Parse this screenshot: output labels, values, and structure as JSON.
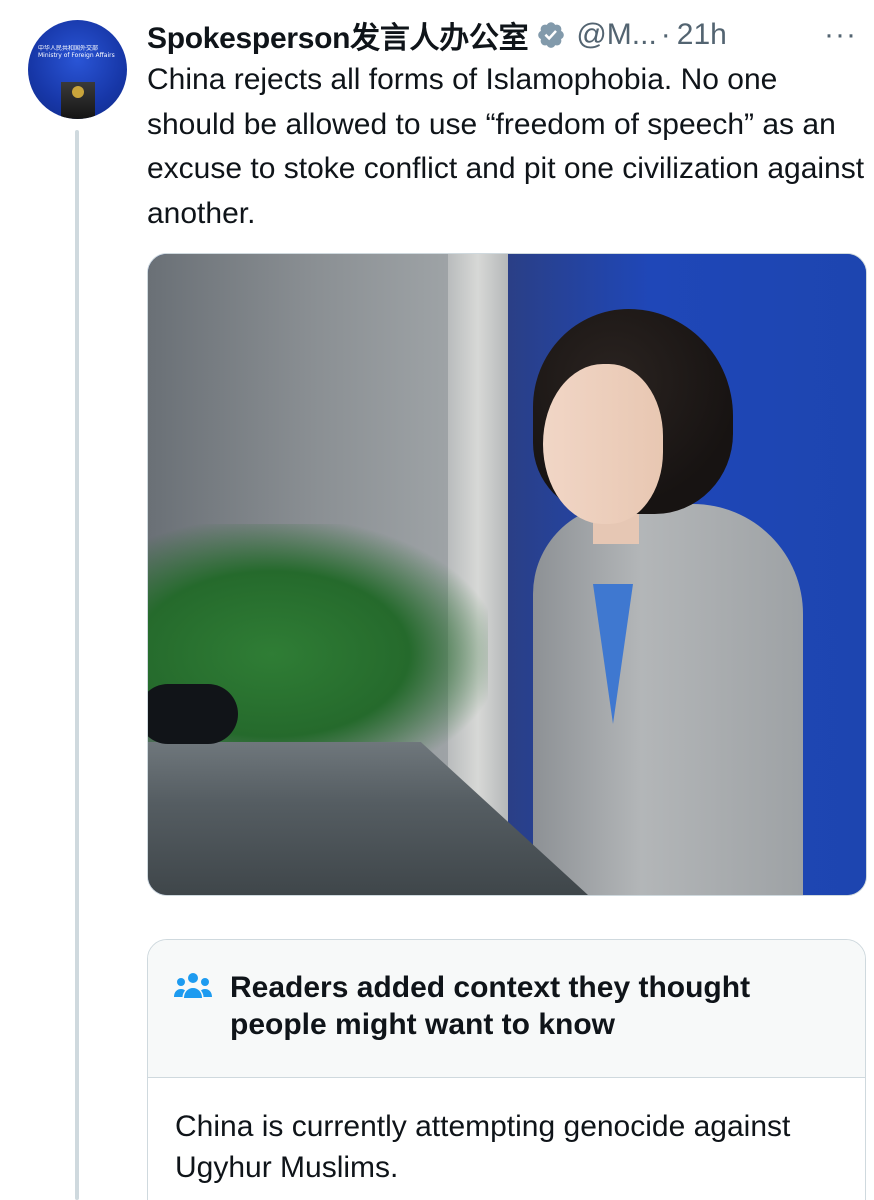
{
  "author": {
    "display_name": "Spokesperson发言人办公室",
    "handle": "@M...",
    "separator": "·",
    "timestamp": "21h",
    "verified_icon": "verified-badge-icon",
    "more_label": "···",
    "avatar_lines": [
      "中华人民共和国外交部",
      "Ministry of Foreign Affairs"
    ]
  },
  "tweet": {
    "text": "China rejects all forms of Islamophobia. No one should be allowed to use “freedom of speech” as an excuse to stoke conflict and pit one civilization against another."
  },
  "community_note": {
    "icon": "people-icon",
    "title": "Readers added context they thought people might want to know",
    "body": "China is currently attempting genocide against Ugyhur Muslims."
  },
  "colors": {
    "text_primary": "#0f1419",
    "text_secondary": "#536471",
    "verified": "#829aab",
    "note_icon": "#1d9bf0",
    "border": "#cfd9de"
  }
}
